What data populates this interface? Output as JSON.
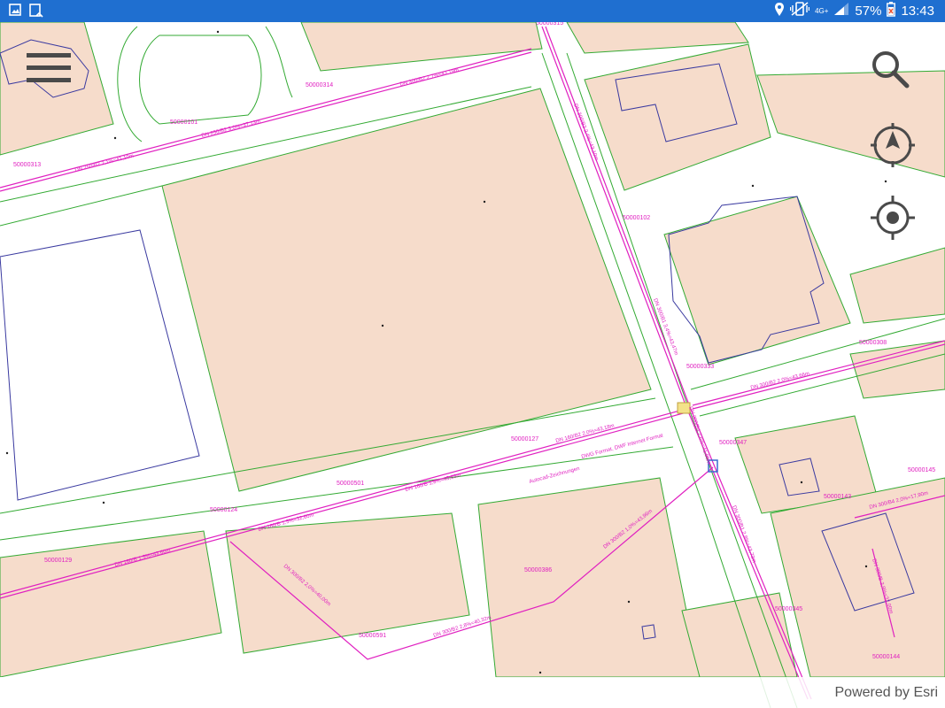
{
  "status_bar": {
    "network": "4G+",
    "battery": "57%",
    "time": "13:43",
    "left_icons": [
      "gallery-icon",
      "download-icon"
    ],
    "right_icons": [
      "location-icon",
      "vibrate-icon",
      "signal-icon",
      "battery-icon"
    ]
  },
  "controls": {
    "menu_icon": "hamburger-menu-icon",
    "search_icon": "search-icon",
    "compass_icon": "compass-icon",
    "locate_icon": "locate-icon"
  },
  "attribution": "Powered by Esri",
  "map_labels": {
    "nodes": [
      "50000313",
      "50000101",
      "50000314",
      "50000315",
      "50000102",
      "50000333",
      "50000308",
      "50000127",
      "50000347",
      "50000501",
      "50000124",
      "50000129",
      "50000386",
      "50000591",
      "50000143",
      "50000145",
      "50000345",
      "50000144"
    ],
    "pipes": [
      "DN 250/B2 2,1%=41,10m",
      "DN 250/B2 3,0%=37,13m",
      "DN 300/B2 2,7%=43,19m",
      "DN 300/B2 2,4%=43,10m",
      "DN 300/B1 3,4%=43,47m",
      "DN 160/B2 2,0%=43,18m",
      "DN 160/B 1,8%=45,63m",
      "DN 160/B 1,5%=32,60m",
      "DN 160/B 1,5%=43,60m",
      "DN 300/B2 2,0%=43,66m",
      "DN 300/B2 1,0%=43,96m",
      "DN 300/B2 2,0%=40,00m",
      "DN 300/B2 2,8%=40,32m",
      "DN 300/B4 2,0%=17,90m",
      "DN 300/B 2,9%=32,00m",
      "DN 300/B1 2,8%=43,73m",
      "DN 300/B4 2,6%=41,05m"
    ],
    "notes": [
      "DWG Format, DWF Internet Format",
      "Autocad-Zeichnungen"
    ]
  },
  "colors": {
    "status_bar": "#1f6fd0",
    "parcel_fill": "#f6dccb",
    "parcel_edge": "#33aa33",
    "building_edge": "#3a3aa0",
    "pipe": "#e020c0"
  }
}
